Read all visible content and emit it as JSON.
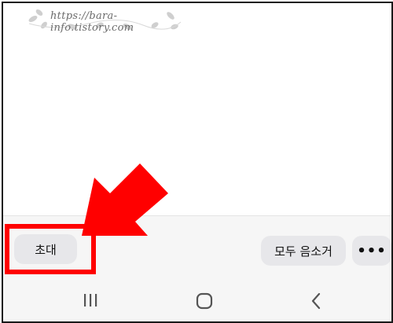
{
  "watermark": {
    "text": "https://bara-info.tistory.com"
  },
  "call_controls": {
    "invite_label": "초대",
    "mute_all_label": "모두 음소거",
    "more_label": "•••"
  },
  "navigation": {
    "recents_icon": "recents-icon",
    "home_icon": "home-icon",
    "back_icon": "back-icon"
  },
  "colors": {
    "highlight": "#ff0000",
    "button_bg": "#e7e7ea",
    "bar_bg": "#f6f6f6"
  }
}
